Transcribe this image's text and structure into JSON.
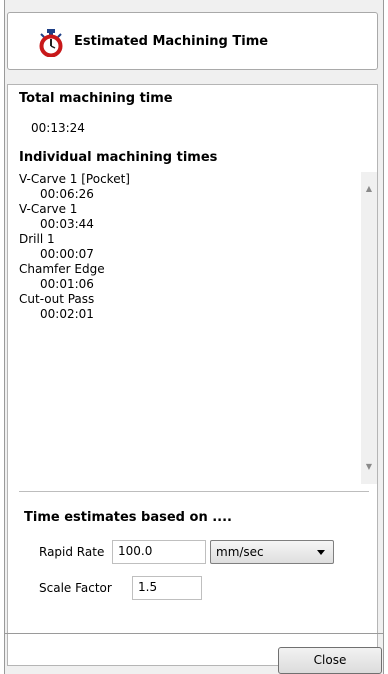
{
  "header": {
    "title": "Estimated Machining Time",
    "icon": "stopwatch-icon"
  },
  "total": {
    "label": "Total machining time",
    "value": "00:13:24"
  },
  "individual": {
    "label": "Individual  machining times",
    "items": [
      {
        "name": "V-Carve 1 [Pocket]",
        "time": "00:06:26"
      },
      {
        "name": "V-Carve 1",
        "time": "00:03:44"
      },
      {
        "name": "Drill 1",
        "time": "00:00:07"
      },
      {
        "name": "Chamfer Edge",
        "time": "00:01:06"
      },
      {
        "name": "Cut-out Pass",
        "time": "00:02:01"
      }
    ]
  },
  "basis": {
    "label": "Time estimates based on ....",
    "rapid_rate_label": "Rapid Rate",
    "rapid_rate_value": "100.0",
    "rapid_rate_unit": "mm/sec",
    "scale_factor_label": "Scale Factor",
    "scale_factor_value": "1.5"
  },
  "close_label": "Close"
}
